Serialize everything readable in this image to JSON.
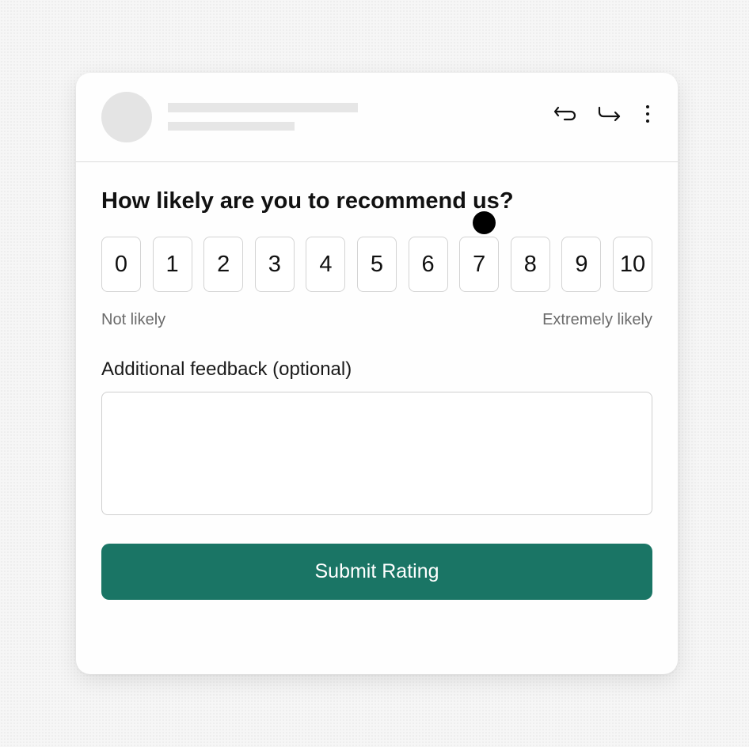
{
  "header": {
    "icons": [
      "reply-icon",
      "forward-icon",
      "more-vertical-icon"
    ]
  },
  "survey": {
    "question": "How likely are you to recommend us?",
    "scale": [
      "0",
      "1",
      "2",
      "3",
      "4",
      "5",
      "6",
      "7",
      "8",
      "9",
      "10"
    ],
    "min_label": "Not likely",
    "max_label": "Extremely likely",
    "feedback_label": "Additional feedback (optional)",
    "feedback_value": "",
    "feedback_placeholder": "",
    "submit_label": "Submit Rating"
  },
  "colors": {
    "accent": "#1a7565",
    "border": "#d3d3d3",
    "hint_text": "#6b6b6b"
  }
}
